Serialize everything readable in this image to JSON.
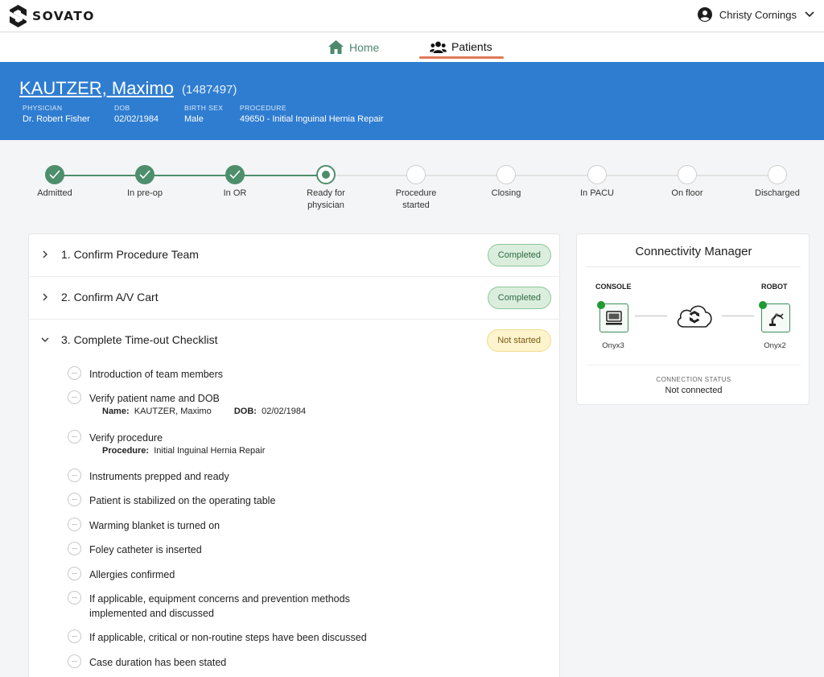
{
  "app": {
    "brand": "SOVATO"
  },
  "user": {
    "name": "Christy Cornings"
  },
  "nav": {
    "tabs": [
      {
        "label": "Home",
        "icon": "home-icon"
      },
      {
        "label": "Patients",
        "icon": "users-icon"
      }
    ],
    "active": "Patients"
  },
  "patient": {
    "name": "KAUTZER, Maximo",
    "id": "(1487497)",
    "fields": [
      {
        "label": "PHYSICIAN",
        "value": "Dr. Robert Fisher"
      },
      {
        "label": "DOB",
        "value": "02/02/1984"
      },
      {
        "label": "BIRTH SEX",
        "value": "Male"
      },
      {
        "label": "PROCEDURE",
        "value": "49650 - Initial Inguinal Hernia Repair"
      }
    ]
  },
  "steps": [
    {
      "label": "Admitted",
      "state": "done"
    },
    {
      "label": "In pre-op",
      "state": "done"
    },
    {
      "label": "In OR",
      "state": "done"
    },
    {
      "label": "Ready for physician",
      "state": "current"
    },
    {
      "label": "Procedure started",
      "state": "todo"
    },
    {
      "label": "Closing",
      "state": "todo"
    },
    {
      "label": "In PACU",
      "state": "todo"
    },
    {
      "label": "On floor",
      "state": "todo"
    },
    {
      "label": "Discharged",
      "state": "todo"
    }
  ],
  "sections": [
    {
      "title": "1. Confirm Procedure Team",
      "status": "Completed",
      "expanded": false
    },
    {
      "title": "2. Confirm A/V Cart",
      "status": "Completed",
      "expanded": false
    },
    {
      "title": "3. Complete Time-out Checklist",
      "status": "Not started",
      "expanded": true
    }
  ],
  "checklist": [
    {
      "text": "Introduction of team members"
    },
    {
      "text": "Verify patient name and DOB",
      "detail": {
        "name_label": "Name:",
        "name_value": "KAUTZER, Maximo",
        "dob_label": "DOB:",
        "dob_value": "02/02/1984"
      }
    },
    {
      "text": "Verify procedure",
      "detail": {
        "proc_label": "Procedure:",
        "proc_value": "Initial Inguinal Hernia Repair"
      }
    },
    {
      "text": "Instruments prepped and ready"
    },
    {
      "text": "Patient is stabilized on the operating table"
    },
    {
      "text": "Warming blanket is turned on"
    },
    {
      "text": "Foley catheter is inserted"
    },
    {
      "text": "Allergies confirmed"
    },
    {
      "text": "If applicable, equipment concerns and prevention methods implemented and discussed"
    },
    {
      "text": "If applicable, critical or non-routine steps have been discussed"
    },
    {
      "text": "Case duration has been stated"
    }
  ],
  "connectivity": {
    "title": "Connectivity Manager",
    "console": {
      "label": "CONSOLE",
      "name": "Onyx3"
    },
    "robot": {
      "label": "ROBOT",
      "name": "Onyx2"
    },
    "status_label": "CONNECTION STATUS",
    "status_value": "Not connected"
  },
  "colors": {
    "primary": "#2f7dd1",
    "success": "#4d8e6c",
    "accent": "#e07858",
    "warning_bg": "#fdf3cc"
  }
}
